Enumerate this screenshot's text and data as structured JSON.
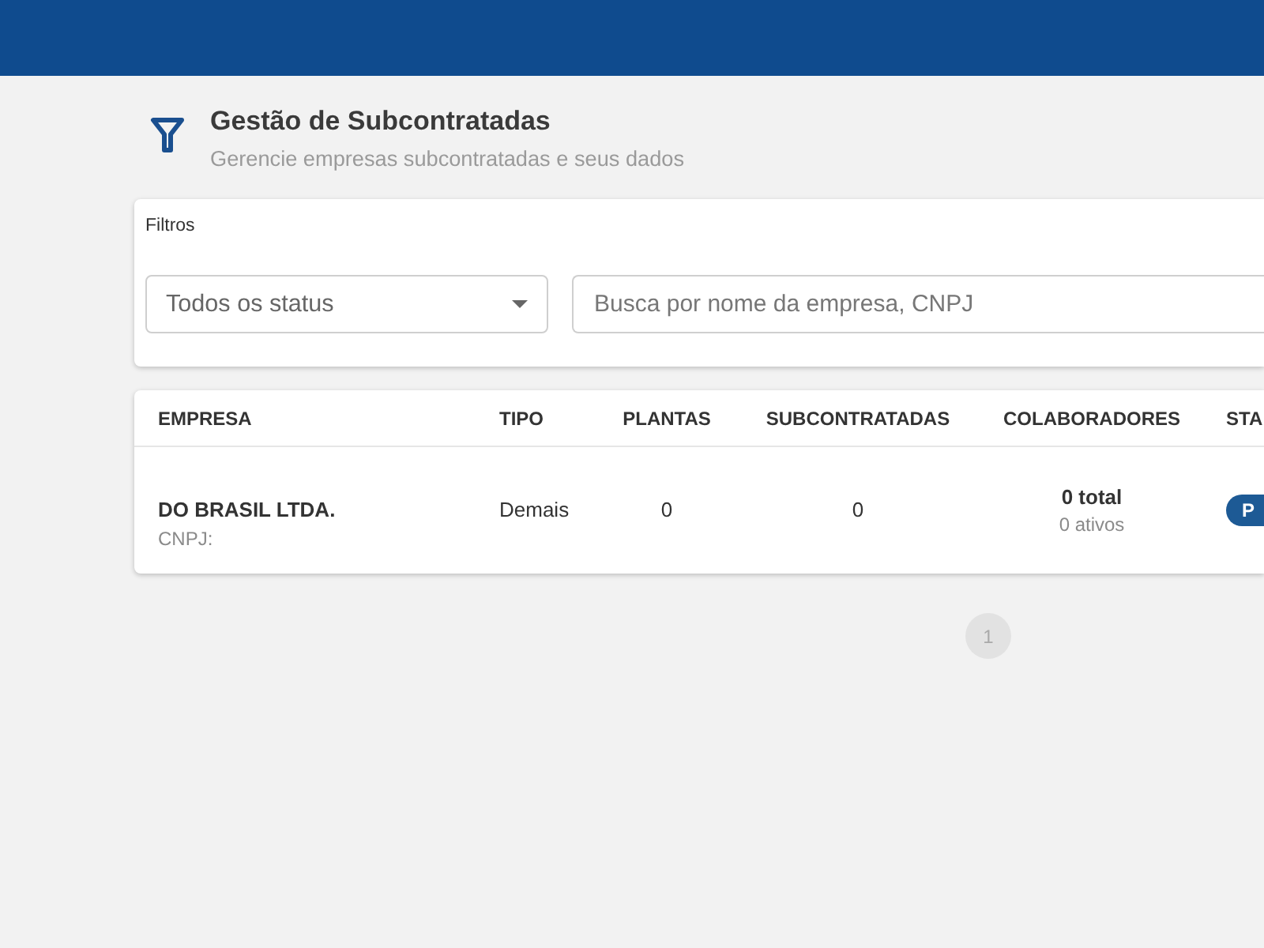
{
  "page": {
    "title": "Gestão de Subcontratadas",
    "subtitle": "Gerencie empresas subcontratadas e seus dados"
  },
  "filters": {
    "title": "Filtros",
    "status_select": {
      "value": "Todos os status"
    },
    "search": {
      "placeholder": "Busca por nome da empresa, CNPJ"
    }
  },
  "table": {
    "columns": [
      "EMPRESA",
      "TIPO",
      "PLANTAS",
      "SUBCONTRATADAS",
      "COLABORADORES",
      "STA"
    ],
    "rows": [
      {
        "empresa": "DO BRASIL LTDA.",
        "cnpj": "CNPJ:",
        "tipo": "Demais",
        "plantas": "0",
        "subcontratadas": "0",
        "colaboradores_total": "0 total",
        "colaboradores_ativos": "0 ativos",
        "status": "P"
      }
    ]
  },
  "pagination": {
    "pages": [
      {
        "label": "1",
        "selected": true
      }
    ]
  }
}
